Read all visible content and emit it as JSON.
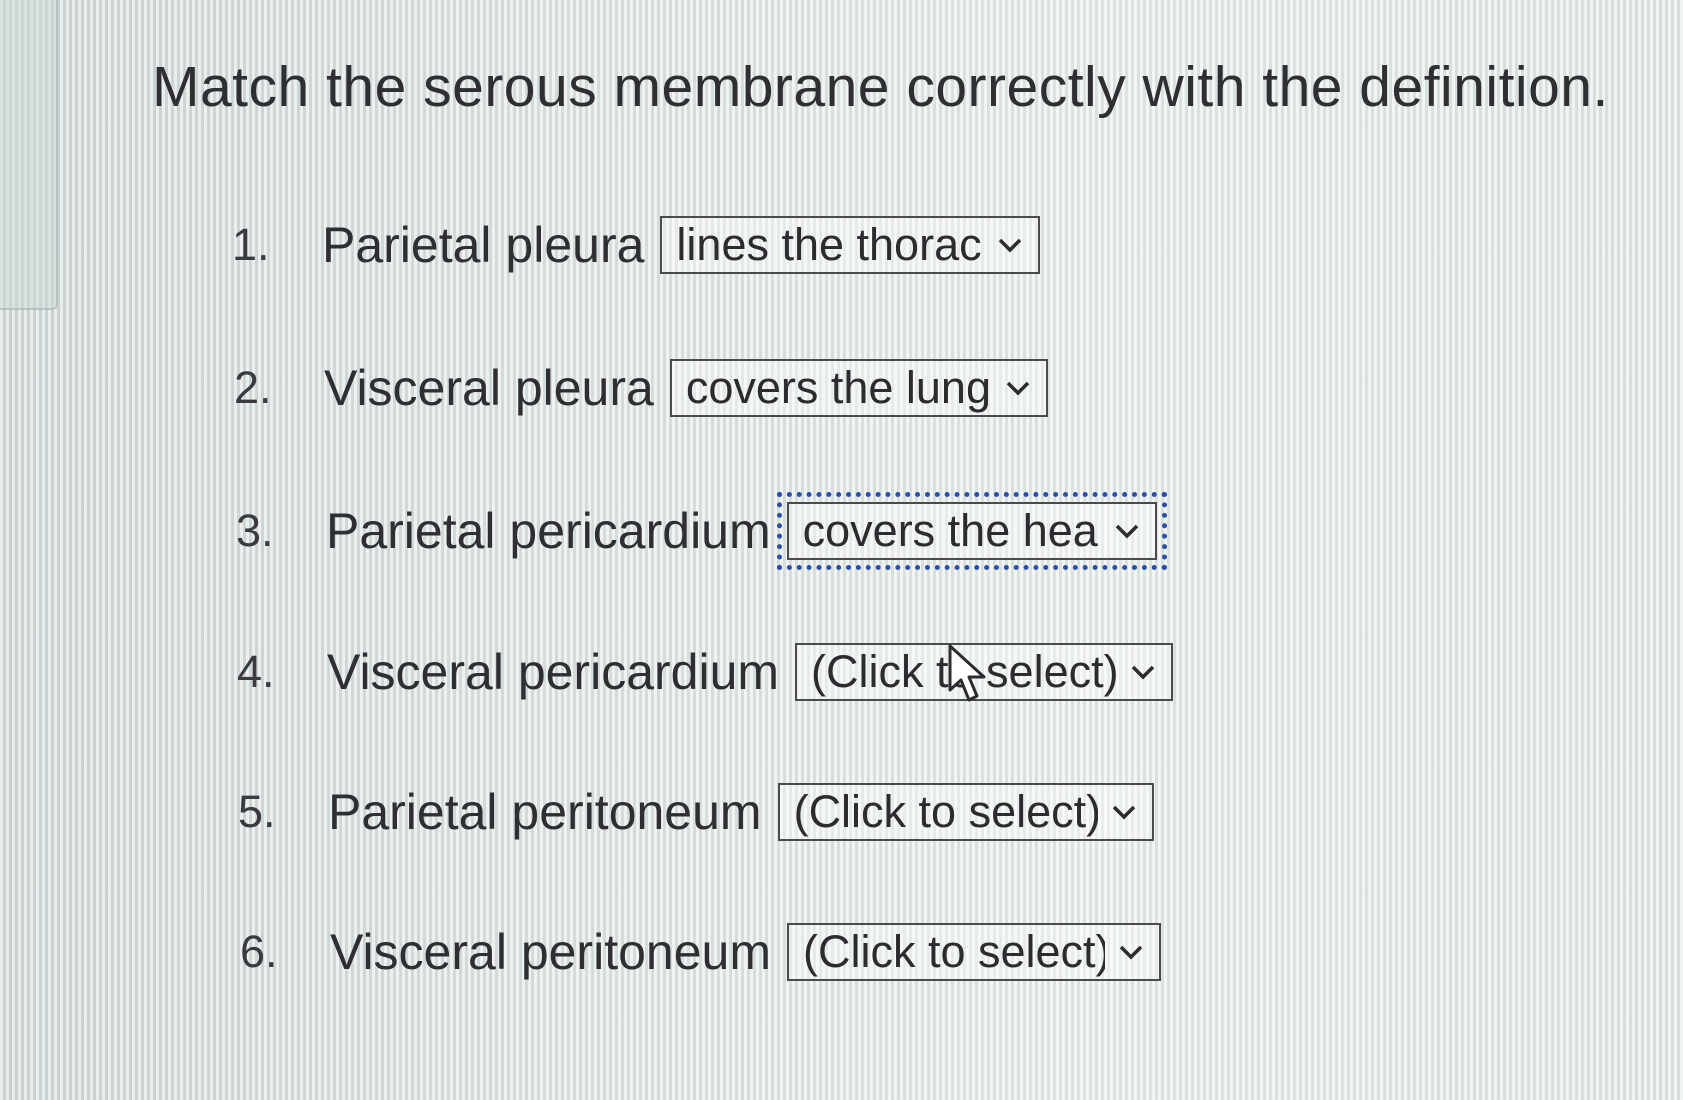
{
  "question": {
    "title": "Match the serous membrane correctly with the definition."
  },
  "items": [
    {
      "number": "1.",
      "term": "Parietal pleura",
      "selected": "lines the thorac"
    },
    {
      "number": "2.",
      "term": "Visceral pleura",
      "selected": "covers the lung"
    },
    {
      "number": "3.",
      "term": "Parietal pericardium",
      "selected": "covers the hear"
    },
    {
      "number": "4.",
      "term": "Visceral pericardium",
      "selected": "(Click to select)"
    },
    {
      "number": "5.",
      "term": "Parietal peritoneum",
      "selected": "(Click to select)"
    },
    {
      "number": "6.",
      "term": "Visceral peritoneum",
      "selected": "(Click to select)"
    }
  ],
  "icons": {
    "dropdown": "chevron-down-icon",
    "pointer": "mouse-pointer-icon"
  },
  "colors": {
    "focus_outline": "#2a50a8",
    "text": "#2e2e33",
    "select_border": "#4a4a4f"
  }
}
